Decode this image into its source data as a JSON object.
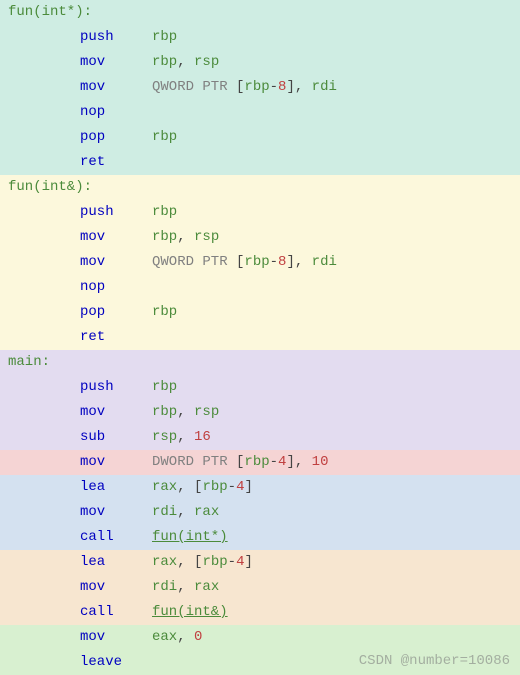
{
  "chart_data": {
    "type": "table",
    "title": "x86-64 assembly listing",
    "blocks": [
      {
        "label": "fun(int*):",
        "bg": "bg-teal",
        "rows": [
          {
            "mn": "push",
            "ops": [
              {
                "t": "reg",
                "v": "rbp"
              }
            ]
          },
          {
            "mn": "mov",
            "ops": [
              {
                "t": "reg",
                "v": "rbp"
              },
              {
                "t": "pun",
                "v": ", "
              },
              {
                "t": "reg",
                "v": "rsp"
              }
            ]
          },
          {
            "mn": "mov",
            "ops": [
              {
                "t": "kw",
                "v": "QWORD PTR "
              },
              {
                "t": "pun",
                "v": "["
              },
              {
                "t": "reg",
                "v": "rbp"
              },
              {
                "t": "pun",
                "v": "-"
              },
              {
                "t": "num",
                "v": "8"
              },
              {
                "t": "pun",
                "v": "], "
              },
              {
                "t": "reg",
                "v": "rdi"
              }
            ]
          },
          {
            "mn": "nop",
            "ops": []
          },
          {
            "mn": "pop",
            "ops": [
              {
                "t": "reg",
                "v": "rbp"
              }
            ]
          },
          {
            "mn": "ret",
            "ops": []
          }
        ]
      },
      {
        "label": "fun(int&):",
        "bg": "bg-yellow",
        "rows": [
          {
            "mn": "push",
            "ops": [
              {
                "t": "reg",
                "v": "rbp"
              }
            ]
          },
          {
            "mn": "mov",
            "ops": [
              {
                "t": "reg",
                "v": "rbp"
              },
              {
                "t": "pun",
                "v": ", "
              },
              {
                "t": "reg",
                "v": "rsp"
              }
            ]
          },
          {
            "mn": "mov",
            "ops": [
              {
                "t": "kw",
                "v": "QWORD PTR "
              },
              {
                "t": "pun",
                "v": "["
              },
              {
                "t": "reg",
                "v": "rbp"
              },
              {
                "t": "pun",
                "v": "-"
              },
              {
                "t": "num",
                "v": "8"
              },
              {
                "t": "pun",
                "v": "], "
              },
              {
                "t": "reg",
                "v": "rdi"
              }
            ]
          },
          {
            "mn": "nop",
            "ops": []
          },
          {
            "mn": "pop",
            "ops": [
              {
                "t": "reg",
                "v": "rbp"
              }
            ]
          },
          {
            "mn": "ret",
            "ops": []
          }
        ]
      }
    ],
    "main_label": "main:",
    "main_rows": [
      {
        "bg": "bg-purple",
        "mn": "push",
        "ops": [
          {
            "t": "reg",
            "v": "rbp"
          }
        ]
      },
      {
        "bg": "bg-purple",
        "mn": "mov",
        "ops": [
          {
            "t": "reg",
            "v": "rbp"
          },
          {
            "t": "pun",
            "v": ", "
          },
          {
            "t": "reg",
            "v": "rsp"
          }
        ]
      },
      {
        "bg": "bg-purple",
        "mn": "sub",
        "ops": [
          {
            "t": "reg",
            "v": "rsp"
          },
          {
            "t": "pun",
            "v": ", "
          },
          {
            "t": "num",
            "v": "16"
          }
        ]
      },
      {
        "bg": "bg-pink",
        "mn": "mov",
        "ops": [
          {
            "t": "kw",
            "v": "DWORD PTR "
          },
          {
            "t": "pun",
            "v": "["
          },
          {
            "t": "reg",
            "v": "rbp"
          },
          {
            "t": "pun",
            "v": "-"
          },
          {
            "t": "num",
            "v": "4"
          },
          {
            "t": "pun",
            "v": "], "
          },
          {
            "t": "num",
            "v": "10"
          }
        ]
      },
      {
        "bg": "bg-blue",
        "mn": "lea",
        "ops": [
          {
            "t": "reg",
            "v": "rax"
          },
          {
            "t": "pun",
            "v": ", ["
          },
          {
            "t": "reg",
            "v": "rbp"
          },
          {
            "t": "pun",
            "v": "-"
          },
          {
            "t": "num",
            "v": "4"
          },
          {
            "t": "pun",
            "v": "]"
          }
        ]
      },
      {
        "bg": "bg-blue",
        "mn": "mov",
        "ops": [
          {
            "t": "reg",
            "v": "rdi"
          },
          {
            "t": "pun",
            "v": ", "
          },
          {
            "t": "reg",
            "v": "rax"
          }
        ]
      },
      {
        "bg": "bg-blue",
        "mn": "call",
        "ops": [
          {
            "t": "call",
            "v": "fun(int*)"
          }
        ]
      },
      {
        "bg": "bg-orange",
        "mn": "lea",
        "ops": [
          {
            "t": "reg",
            "v": "rax"
          },
          {
            "t": "pun",
            "v": ", ["
          },
          {
            "t": "reg",
            "v": "rbp"
          },
          {
            "t": "pun",
            "v": "-"
          },
          {
            "t": "num",
            "v": "4"
          },
          {
            "t": "pun",
            "v": "]"
          }
        ]
      },
      {
        "bg": "bg-orange",
        "mn": "mov",
        "ops": [
          {
            "t": "reg",
            "v": "rdi"
          },
          {
            "t": "pun",
            "v": ", "
          },
          {
            "t": "reg",
            "v": "rax"
          }
        ]
      },
      {
        "bg": "bg-orange",
        "mn": "call",
        "ops": [
          {
            "t": "call",
            "v": "fun(int&)"
          }
        ]
      },
      {
        "bg": "bg-green",
        "mn": "mov",
        "ops": [
          {
            "t": "reg",
            "v": "eax"
          },
          {
            "t": "pun",
            "v": ", "
          },
          {
            "t": "num",
            "v": "0"
          }
        ]
      },
      {
        "bg": "bg-green",
        "mn": "leave",
        "ops": []
      }
    ]
  },
  "watermark": "CSDN @number=10086"
}
